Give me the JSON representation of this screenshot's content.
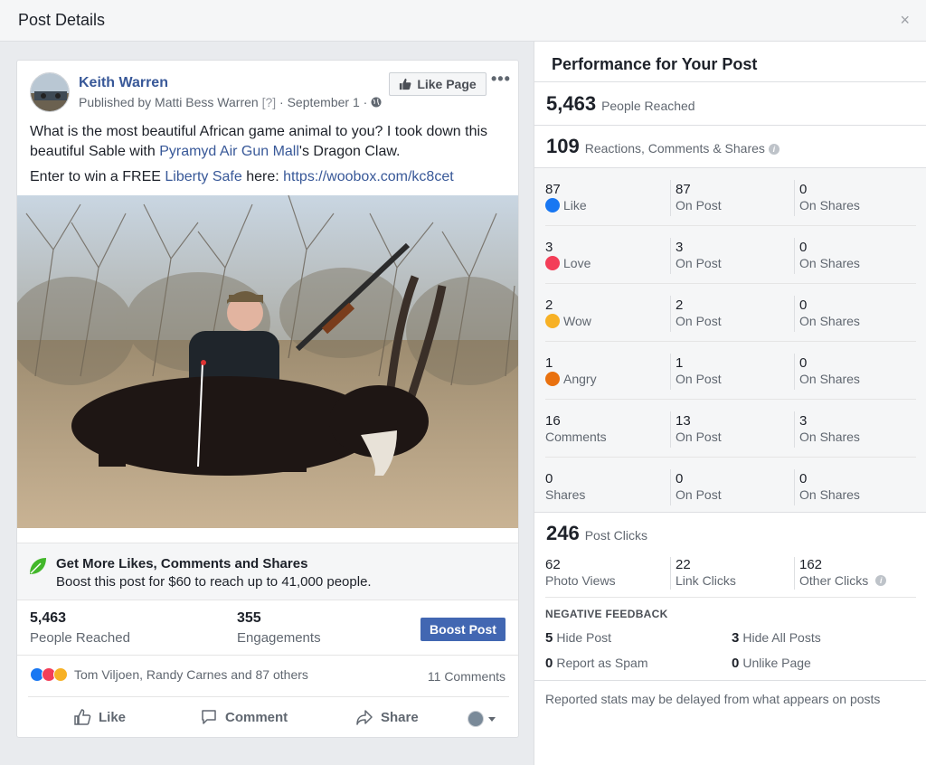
{
  "window": {
    "title": "Post Details",
    "close": "×"
  },
  "post": {
    "author": "Keith Warren",
    "published_by": "Published by Matti Bess Warren",
    "q": "[?]",
    "date": "· September 1 ·",
    "like_page": "Like Page",
    "more": "•••",
    "text1_a": "What is the most beautiful African game animal to you? I took down this beautiful Sable with ",
    "text1_link": "Pyramyd Air Gun Mall",
    "text1_b": "'s Dragon Claw.",
    "text2_a": "Enter to win a FREE ",
    "text2_link1": "Liberty Safe",
    "text2_mid": " here: ",
    "text2_link2": "https://woobox.com/kc8cet"
  },
  "boost": {
    "headline": "Get More Likes, Comments and Shares",
    "sub": "Boost this post for $60 to reach up to 41,000 people.",
    "button": "Boost Post"
  },
  "post_stats": {
    "reached_value": "5,463",
    "reached_label": "People Reached",
    "engagements_value": "355",
    "engagements_label": "Engagements"
  },
  "reactions": {
    "names": "Tom Viljoen, Randy Carnes and 87 others",
    "comments": "11 Comments"
  },
  "actions": {
    "like": "Like",
    "comment": "Comment",
    "share": "Share"
  },
  "performance": {
    "title": "Performance for Your Post",
    "reached_value": "5,463",
    "reached_label": "People Reached",
    "rcs_value": "109",
    "rcs_label": "Reactions, Comments & Shares",
    "rows": [
      {
        "total": "87",
        "label": "Like",
        "on_post": "87",
        "on_post_label": "On Post",
        "on_shares": "0",
        "on_shares_label": "On Shares"
      },
      {
        "total": "3",
        "label": "Love",
        "on_post": "3",
        "on_post_label": "On Post",
        "on_shares": "0",
        "on_shares_label": "On Shares"
      },
      {
        "total": "2",
        "label": "Wow",
        "on_post": "2",
        "on_post_label": "On Post",
        "on_shares": "0",
        "on_shares_label": "On Shares"
      },
      {
        "total": "1",
        "label": "Angry",
        "on_post": "1",
        "on_post_label": "On Post",
        "on_shares": "0",
        "on_shares_label": "On Shares"
      },
      {
        "total": "16",
        "label": "Comments",
        "on_post": "13",
        "on_post_label": "On Post",
        "on_shares": "3",
        "on_shares_label": "On Shares"
      },
      {
        "total": "0",
        "label": "Shares",
        "on_post": "0",
        "on_post_label": "On Post",
        "on_shares": "0",
        "on_shares_label": "On Shares"
      }
    ],
    "clicks_value": "246",
    "clicks_label": "Post Clicks",
    "photo_views_value": "62",
    "photo_views_label": "Photo Views",
    "link_clicks_value": "22",
    "link_clicks_label": "Link Clicks",
    "other_clicks_value": "162",
    "other_clicks_label": "Other Clicks",
    "negative_title": "NEGATIVE FEEDBACK",
    "hide_post_value": "5",
    "hide_post_label": "Hide Post",
    "hide_all_value": "3",
    "hide_all_label": "Hide All Posts",
    "spam_value": "0",
    "spam_label": "Report as Spam",
    "unlike_value": "0",
    "unlike_label": "Unlike Page",
    "footnote": "Reported stats may be delayed from what appears on posts"
  },
  "colors": {
    "link": "#385898",
    "brand": "#4267b2",
    "like": "#1877f2",
    "love": "#f33e58",
    "wow": "#f7b125",
    "angry": "#e9710f"
  }
}
